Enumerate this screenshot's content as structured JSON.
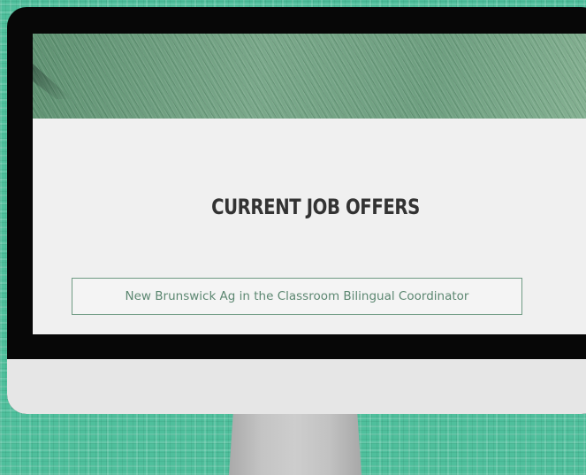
{
  "page": {
    "section_title": "CURRENT JOB OFFERS",
    "job_listings": [
      {
        "title": "New Brunswick Ag in the Classroom Bilingual Coordinator"
      }
    ]
  },
  "colors": {
    "background": "#4fbf9c",
    "monitor_bezel": "#070707",
    "monitor_chin": "#e6e6e6",
    "screen_background": "#f0f0f0",
    "accent_green": "#5c8771",
    "title_text": "#333333"
  }
}
